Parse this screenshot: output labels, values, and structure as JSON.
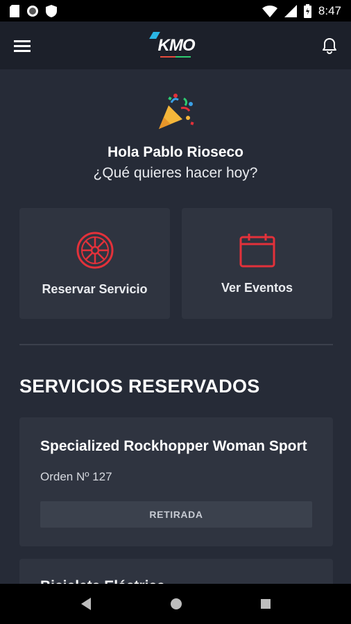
{
  "status_bar": {
    "time": "8:47",
    "icons": [
      "sd-card-icon",
      "circle-icon",
      "shield-icon",
      "wifi-icon",
      "signal-icon",
      "battery-icon"
    ]
  },
  "app_bar": {
    "logo_text": "KMO",
    "icons": [
      "menu-icon",
      "bell-icon"
    ]
  },
  "hero": {
    "emoji": "🎉",
    "greeting": "Hola Pablo Rioseco",
    "question": "¿Qué quieres hacer hoy?"
  },
  "actions": [
    {
      "label": "Reservar Servicio",
      "icon": "wheel-icon"
    },
    {
      "label": "Ver Eventos",
      "icon": "calendar-icon"
    }
  ],
  "section_title": "SERVICIOS RESERVADOS",
  "orders": [
    {
      "title": "Specialized Rockhopper Woman Sport",
      "number": "Orden Nº 127",
      "status": "RETIRADA"
    },
    {
      "title": "Bicicleta Eléctrica"
    }
  ],
  "colors": {
    "accent_red": "#e3313a",
    "background": "#262b37",
    "app_bar": "#1c202a",
    "card": "#2f3440"
  }
}
